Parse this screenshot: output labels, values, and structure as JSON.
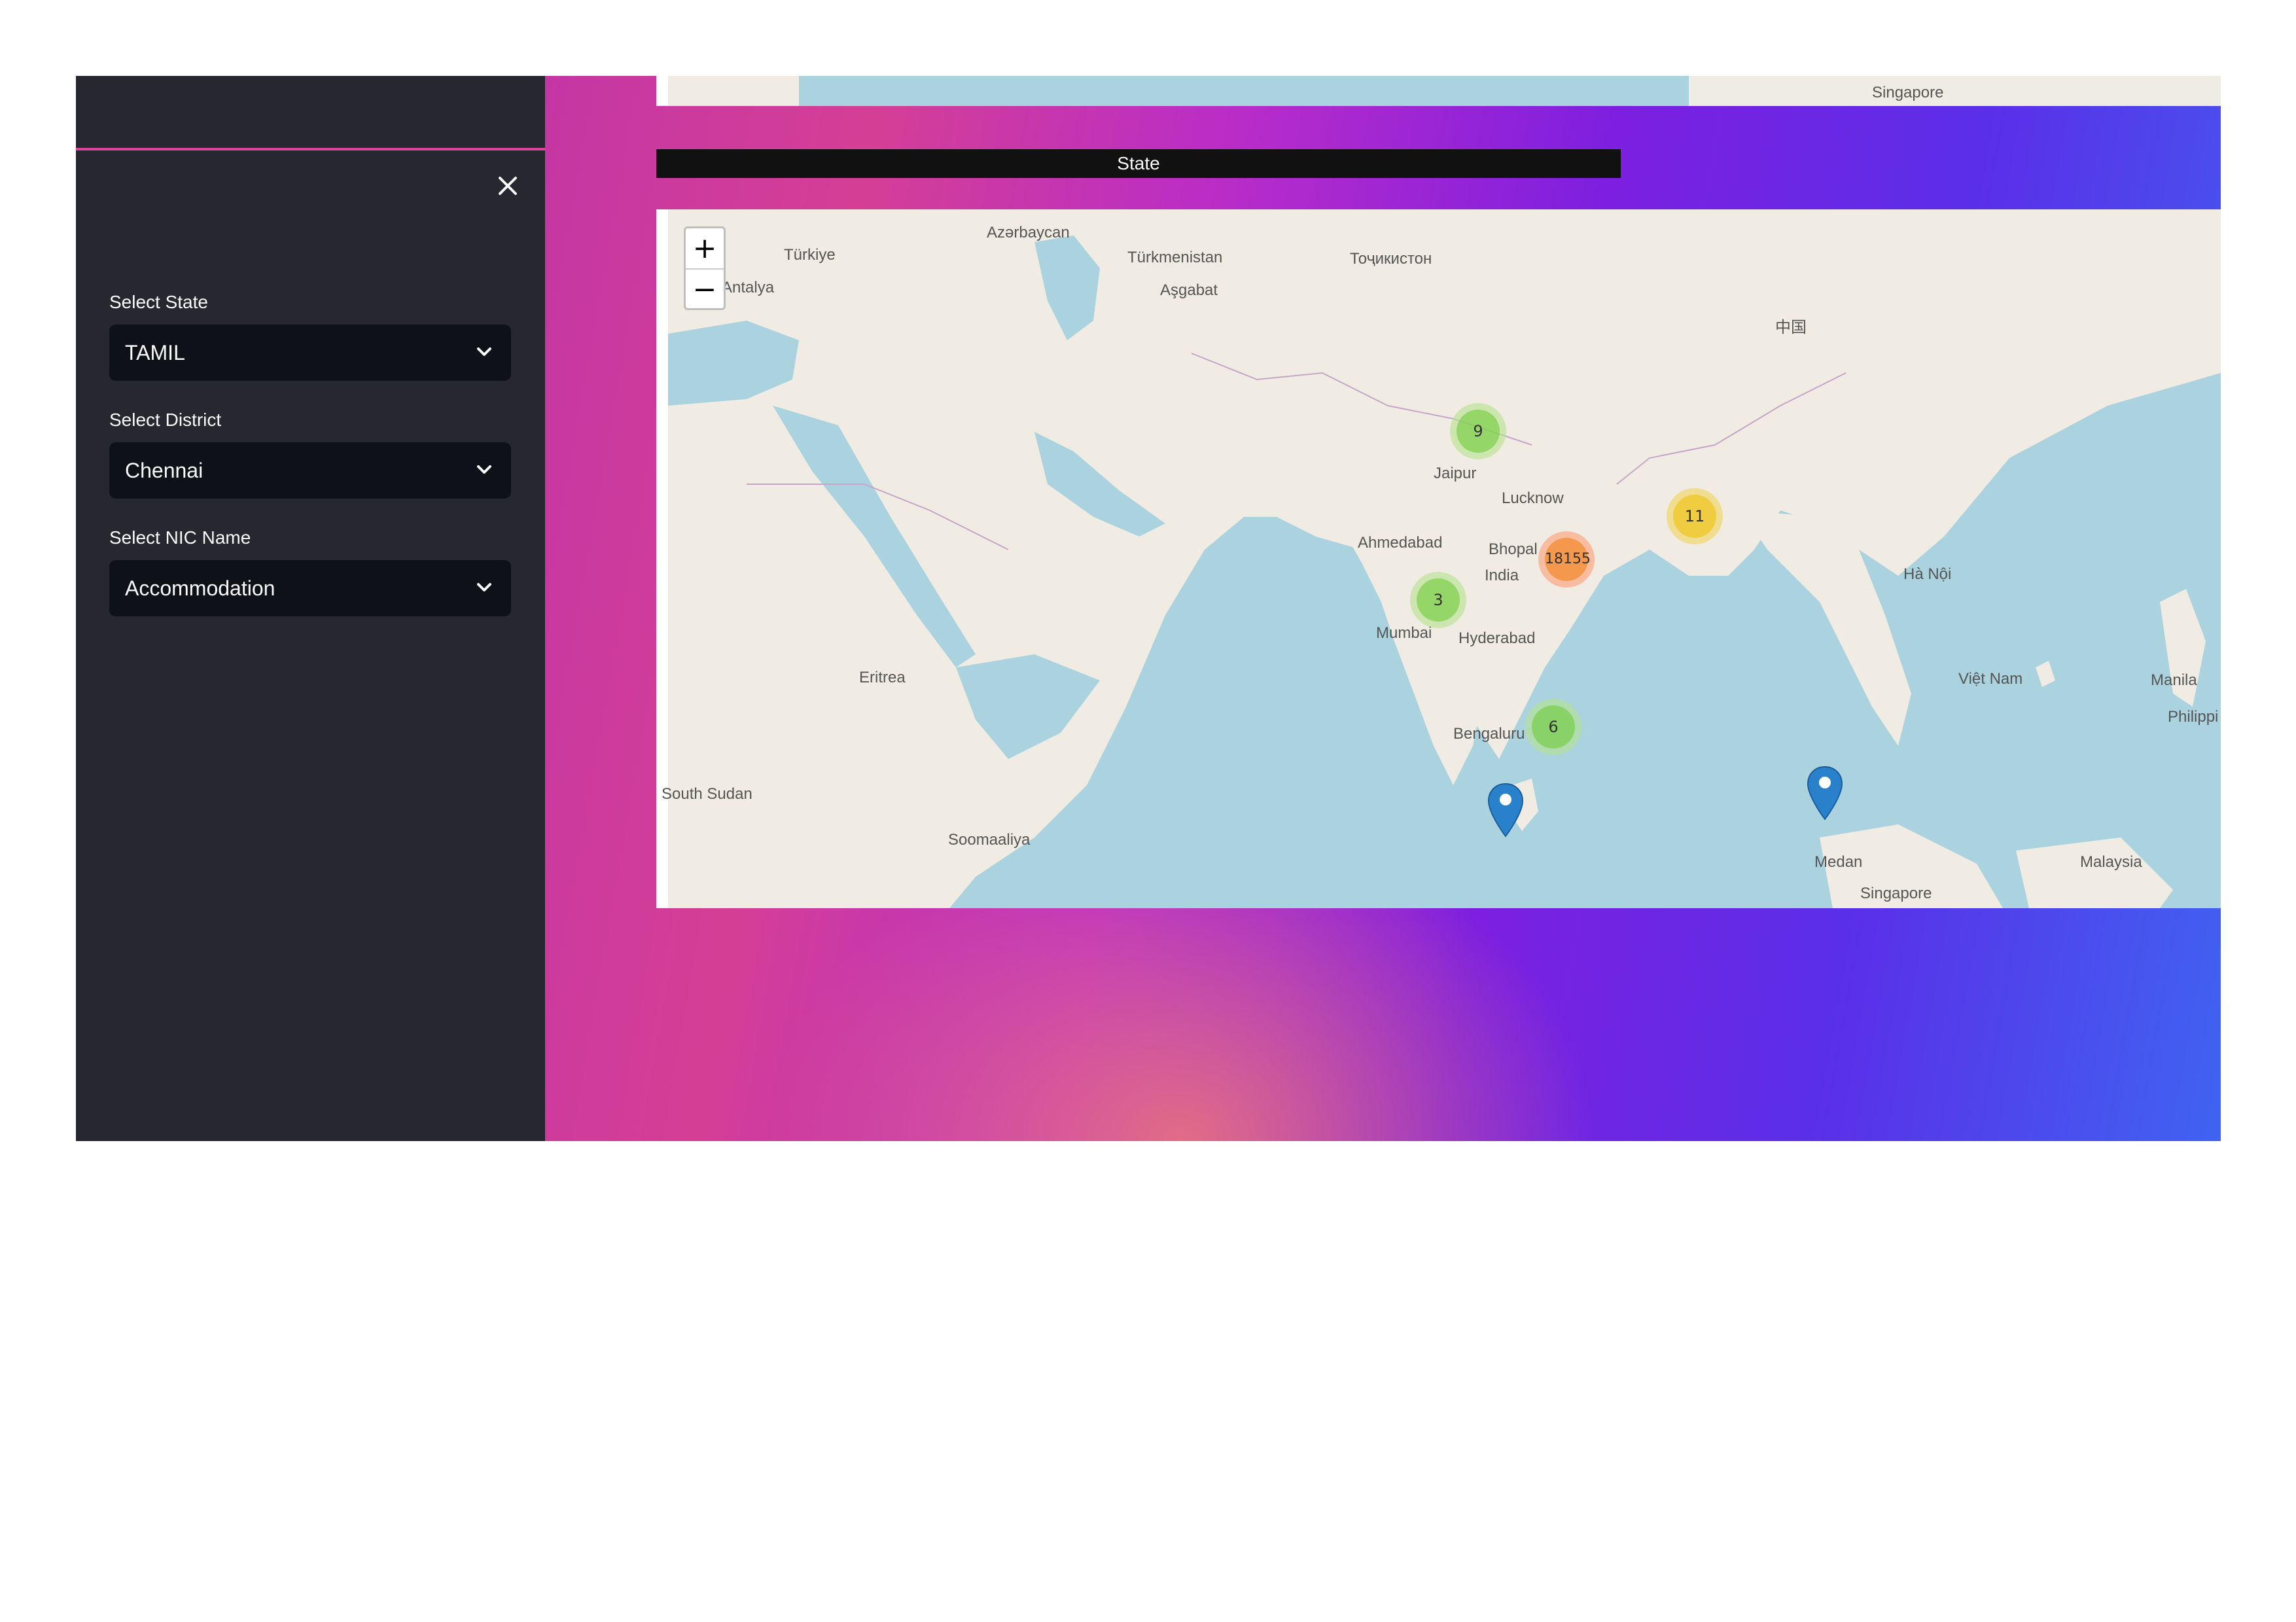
{
  "sidebar": {
    "close_icon": "close-icon",
    "filters": [
      {
        "label": "Select State",
        "value": "TAMIL"
      },
      {
        "label": "Select District",
        "value": "Chennai"
      },
      {
        "label": "Select NIC Name",
        "value": "Accommodation"
      }
    ]
  },
  "main": {
    "section_title": "State",
    "map": {
      "zoom_in": "+",
      "zoom_out": "−",
      "place_labels": {
        "antalya": "Antalya",
        "turkiye": "Türkiye",
        "ashgabat": "Aşgabat",
        "turkmenistan": "Türkmenistan",
        "tajikistan": "Тоҷикистон",
        "azerbaijan": "Azərbaycan",
        "jaipur": "Jaipur",
        "lucknow": "Lucknow",
        "ahmedabad": "Ahmedabad",
        "bhopal": "Bhopal",
        "india": "India",
        "mumbai": "Mumbai",
        "hyderabad": "Hyderabad",
        "bengaluru": "Bengaluru",
        "eritrea": "Eritrea",
        "south_sudan": "South Sudan",
        "somaaliya": "Soomaaliya",
        "medan": "Medan",
        "singapore": "Singapore",
        "malaysia": "Malaysia",
        "hanoi": "Hà Nội",
        "vietnam": "Việt Nam",
        "manila": "Manila",
        "philippines": "Philippi",
        "china": "中国"
      },
      "strip_labels": {
        "singapore": "Singapore"
      },
      "clusters": [
        {
          "label": "9",
          "size": "small"
        },
        {
          "label": "11",
          "size": "medium"
        },
        {
          "label": "18155",
          "size": "large"
        },
        {
          "label": "3",
          "size": "small"
        },
        {
          "label": "6",
          "size": "small"
        }
      ],
      "markers": [
        "location-pin-icon",
        "location-pin-icon"
      ]
    }
  },
  "colors": {
    "sidebar_bg": "#262730",
    "select_bg": "#0e1117",
    "accent_line": "#e0459a",
    "water": "#aad3df",
    "land": "#f0ece4",
    "marker_blue": "#2a81cb"
  }
}
